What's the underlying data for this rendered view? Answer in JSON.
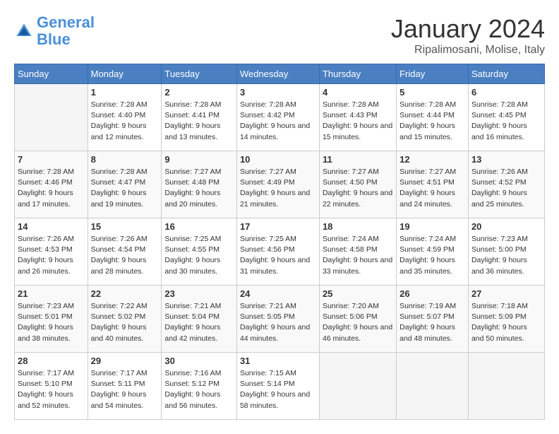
{
  "header": {
    "logo_line1": "General",
    "logo_line2": "Blue",
    "month_title": "January 2024",
    "location": "Ripalimosani, Molise, Italy"
  },
  "days_of_week": [
    "Sunday",
    "Monday",
    "Tuesday",
    "Wednesday",
    "Thursday",
    "Friday",
    "Saturday"
  ],
  "weeks": [
    [
      {
        "num": "",
        "sunrise": "",
        "sunset": "",
        "daylight": ""
      },
      {
        "num": "1",
        "sunrise": "7:28 AM",
        "sunset": "4:40 PM",
        "daylight": "9 hours and 12 minutes."
      },
      {
        "num": "2",
        "sunrise": "7:28 AM",
        "sunset": "4:41 PM",
        "daylight": "9 hours and 13 minutes."
      },
      {
        "num": "3",
        "sunrise": "7:28 AM",
        "sunset": "4:42 PM",
        "daylight": "9 hours and 14 minutes."
      },
      {
        "num": "4",
        "sunrise": "7:28 AM",
        "sunset": "4:43 PM",
        "daylight": "9 hours and 15 minutes."
      },
      {
        "num": "5",
        "sunrise": "7:28 AM",
        "sunset": "4:44 PM",
        "daylight": "9 hours and 15 minutes."
      },
      {
        "num": "6",
        "sunrise": "7:28 AM",
        "sunset": "4:45 PM",
        "daylight": "9 hours and 16 minutes."
      }
    ],
    [
      {
        "num": "7",
        "sunrise": "7:28 AM",
        "sunset": "4:46 PM",
        "daylight": "9 hours and 17 minutes."
      },
      {
        "num": "8",
        "sunrise": "7:28 AM",
        "sunset": "4:47 PM",
        "daylight": "9 hours and 19 minutes."
      },
      {
        "num": "9",
        "sunrise": "7:27 AM",
        "sunset": "4:48 PM",
        "daylight": "9 hours and 20 minutes."
      },
      {
        "num": "10",
        "sunrise": "7:27 AM",
        "sunset": "4:49 PM",
        "daylight": "9 hours and 21 minutes."
      },
      {
        "num": "11",
        "sunrise": "7:27 AM",
        "sunset": "4:50 PM",
        "daylight": "9 hours and 22 minutes."
      },
      {
        "num": "12",
        "sunrise": "7:27 AM",
        "sunset": "4:51 PM",
        "daylight": "9 hours and 24 minutes."
      },
      {
        "num": "13",
        "sunrise": "7:26 AM",
        "sunset": "4:52 PM",
        "daylight": "9 hours and 25 minutes."
      }
    ],
    [
      {
        "num": "14",
        "sunrise": "7:26 AM",
        "sunset": "4:53 PM",
        "daylight": "9 hours and 26 minutes."
      },
      {
        "num": "15",
        "sunrise": "7:26 AM",
        "sunset": "4:54 PM",
        "daylight": "9 hours and 28 minutes."
      },
      {
        "num": "16",
        "sunrise": "7:25 AM",
        "sunset": "4:55 PM",
        "daylight": "9 hours and 30 minutes."
      },
      {
        "num": "17",
        "sunrise": "7:25 AM",
        "sunset": "4:56 PM",
        "daylight": "9 hours and 31 minutes."
      },
      {
        "num": "18",
        "sunrise": "7:24 AM",
        "sunset": "4:58 PM",
        "daylight": "9 hours and 33 minutes."
      },
      {
        "num": "19",
        "sunrise": "7:24 AM",
        "sunset": "4:59 PM",
        "daylight": "9 hours and 35 minutes."
      },
      {
        "num": "20",
        "sunrise": "7:23 AM",
        "sunset": "5:00 PM",
        "daylight": "9 hours and 36 minutes."
      }
    ],
    [
      {
        "num": "21",
        "sunrise": "7:23 AM",
        "sunset": "5:01 PM",
        "daylight": "9 hours and 38 minutes."
      },
      {
        "num": "22",
        "sunrise": "7:22 AM",
        "sunset": "5:02 PM",
        "daylight": "9 hours and 40 minutes."
      },
      {
        "num": "23",
        "sunrise": "7:21 AM",
        "sunset": "5:04 PM",
        "daylight": "9 hours and 42 minutes."
      },
      {
        "num": "24",
        "sunrise": "7:21 AM",
        "sunset": "5:05 PM",
        "daylight": "9 hours and 44 minutes."
      },
      {
        "num": "25",
        "sunrise": "7:20 AM",
        "sunset": "5:06 PM",
        "daylight": "9 hours and 46 minutes."
      },
      {
        "num": "26",
        "sunrise": "7:19 AM",
        "sunset": "5:07 PM",
        "daylight": "9 hours and 48 minutes."
      },
      {
        "num": "27",
        "sunrise": "7:18 AM",
        "sunset": "5:09 PM",
        "daylight": "9 hours and 50 minutes."
      }
    ],
    [
      {
        "num": "28",
        "sunrise": "7:17 AM",
        "sunset": "5:10 PM",
        "daylight": "9 hours and 52 minutes."
      },
      {
        "num": "29",
        "sunrise": "7:17 AM",
        "sunset": "5:11 PM",
        "daylight": "9 hours and 54 minutes."
      },
      {
        "num": "30",
        "sunrise": "7:16 AM",
        "sunset": "5:12 PM",
        "daylight": "9 hours and 56 minutes."
      },
      {
        "num": "31",
        "sunrise": "7:15 AM",
        "sunset": "5:14 PM",
        "daylight": "9 hours and 58 minutes."
      },
      {
        "num": "",
        "sunrise": "",
        "sunset": "",
        "daylight": ""
      },
      {
        "num": "",
        "sunrise": "",
        "sunset": "",
        "daylight": ""
      },
      {
        "num": "",
        "sunrise": "",
        "sunset": "",
        "daylight": ""
      }
    ]
  ],
  "labels": {
    "sunrise": "Sunrise:",
    "sunset": "Sunset:",
    "daylight": "Daylight:"
  }
}
